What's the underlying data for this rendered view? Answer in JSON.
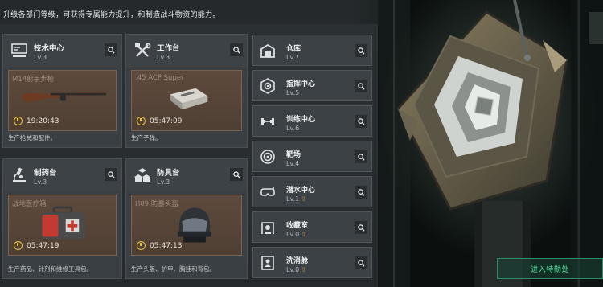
{
  "header": {
    "subtitle": "升级各部门等级，可获得专属能力提升，和制造战斗物资的能力。"
  },
  "workshops": [
    {
      "name": "技术中心",
      "level": "Lv.3",
      "icon": "computer-icon",
      "item": "M14射手步枪",
      "timer": "19:20:43",
      "desc": "生产枪械和配件。"
    },
    {
      "name": "工作台",
      "level": "Lv.3",
      "icon": "tools-icon",
      "item": ".45 ACP Super",
      "timer": "05:47:09",
      "desc": "生产子弹。"
    },
    {
      "name": "制药台",
      "level": "Lv.3",
      "icon": "microscope-icon",
      "item": "战地医疗箱",
      "timer": "05:47:19",
      "desc": "生产药品、针剂和维修工具包。"
    },
    {
      "name": "防具台",
      "level": "Lv.3",
      "icon": "armor-cubes-icon",
      "item": "H09 防暴头盔",
      "timer": "05:47:13",
      "desc": "生产头盔、护甲、胸挂和背包。"
    }
  ],
  "facilities": [
    {
      "name": "仓库",
      "level": "Lv.7",
      "icon": "warehouse-icon",
      "upgradable": false
    },
    {
      "name": "指挥中心",
      "level": "Lv.5",
      "icon": "command-icon",
      "upgradable": false
    },
    {
      "name": "训练中心",
      "level": "Lv.6",
      "icon": "dumbbell-icon",
      "upgradable": false
    },
    {
      "name": "靶场",
      "level": "Lv.4",
      "icon": "target-icon",
      "upgradable": false
    },
    {
      "name": "潜水中心",
      "level": "Lv.1",
      "icon": "diving-mask-icon",
      "upgradable": true
    },
    {
      "name": "收藏室",
      "level": "Lv.0",
      "icon": "collection-icon",
      "upgradable": true
    },
    {
      "name": "洗消舱",
      "level": "Lv.0",
      "icon": "decontamination-icon",
      "upgradable": true
    }
  ],
  "enter_button": "进入特勤处",
  "colors": {
    "accent_green": "#59e6a8",
    "timer_gold": "#e9c64a",
    "upgrade_arrow": "#b68e3c",
    "slot_brown": "#5d4a3c"
  }
}
